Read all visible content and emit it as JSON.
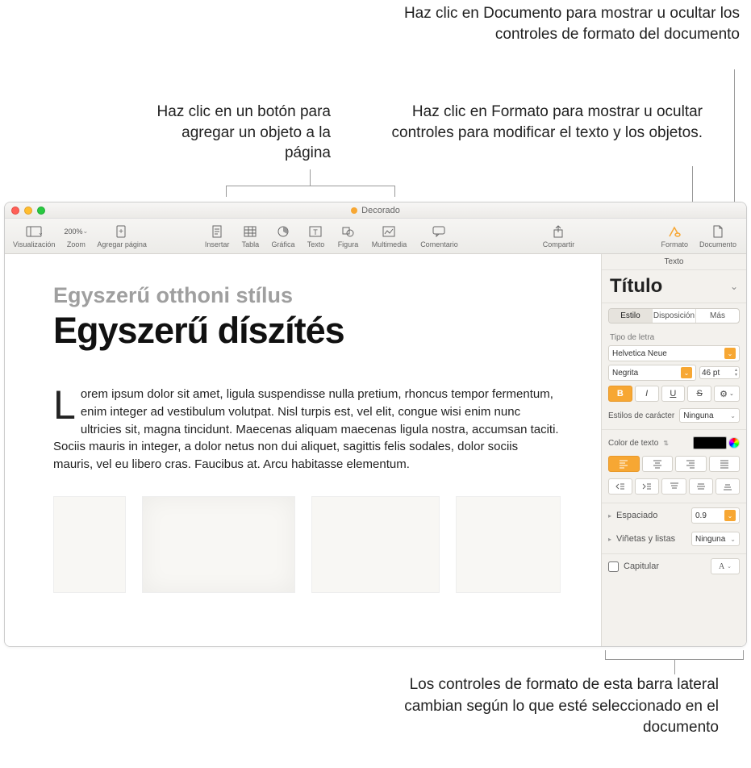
{
  "callouts": {
    "top_right_1": "Haz clic en Documento para mostrar u ocultar los controles de formato del documento",
    "top_right_2": "Haz clic en Formato para mostrar u ocultar controles para modificar el texto y los objetos.",
    "top_left": "Haz clic en un botón para agregar un objeto a la página",
    "bottom": "Los controles de formato de esta barra lateral cambian según lo que esté seleccionado en el documento"
  },
  "window": {
    "title": "Decorado"
  },
  "toolbar": {
    "view_label": "Visualización",
    "zoom_label": "Zoom",
    "zoom_value": "200%",
    "add_page_label": "Agregar página",
    "insert_label": "Insertar",
    "table_label": "Tabla",
    "chart_label": "Gráfica",
    "text_label": "Texto",
    "shape_label": "Figura",
    "media_label": "Multimedia",
    "comment_label": "Comentario",
    "share_label": "Compartir",
    "format_label": "Formato",
    "document_label": "Documento"
  },
  "document": {
    "subtitle": "Egyszerű otthoni stílus",
    "title": "Egyszerű díszítés",
    "body_dropcap": "L",
    "body_text": "orem ipsum dolor sit amet, ligula suspendisse nulla pretium, rhoncus tempor fermentum, enim integer ad vestibulum volutpat. Nisl turpis est, vel elit, congue wisi enim nunc ultricies sit, magna tincidunt. Maecenas aliquam maecenas ligula nostra, accumsan taciti. Sociis mauris in integer, a dolor netus non dui aliquet, sagittis felis sodales, dolor sociis mauris, vel eu libero cras. Faucibus at. Arcu habitasse elementum."
  },
  "sidebar": {
    "tab_header": "Texto",
    "paragraph_style": "Título",
    "seg_tabs": {
      "style": "Estilo",
      "layout": "Disposición",
      "more": "Más"
    },
    "font_section_label": "Tipo de letra",
    "font_family": "Helvetica Neue",
    "font_weight": "Negrita",
    "font_size": "46 pt",
    "style_buttons": {
      "bold": "B",
      "italic": "I",
      "underline": "U",
      "strike": "S"
    },
    "char_styles_label": "Estilos de carácter",
    "char_styles_value": "Ninguna",
    "text_color_label": "Color de texto",
    "text_color_value": "#000000",
    "spacing_label": "Espaciado",
    "spacing_value": "0.9",
    "bullets_label": "Viñetas y listas",
    "bullets_value": "Ninguna",
    "dropcap_label": "Capitular",
    "dropcap_btn": "A"
  }
}
